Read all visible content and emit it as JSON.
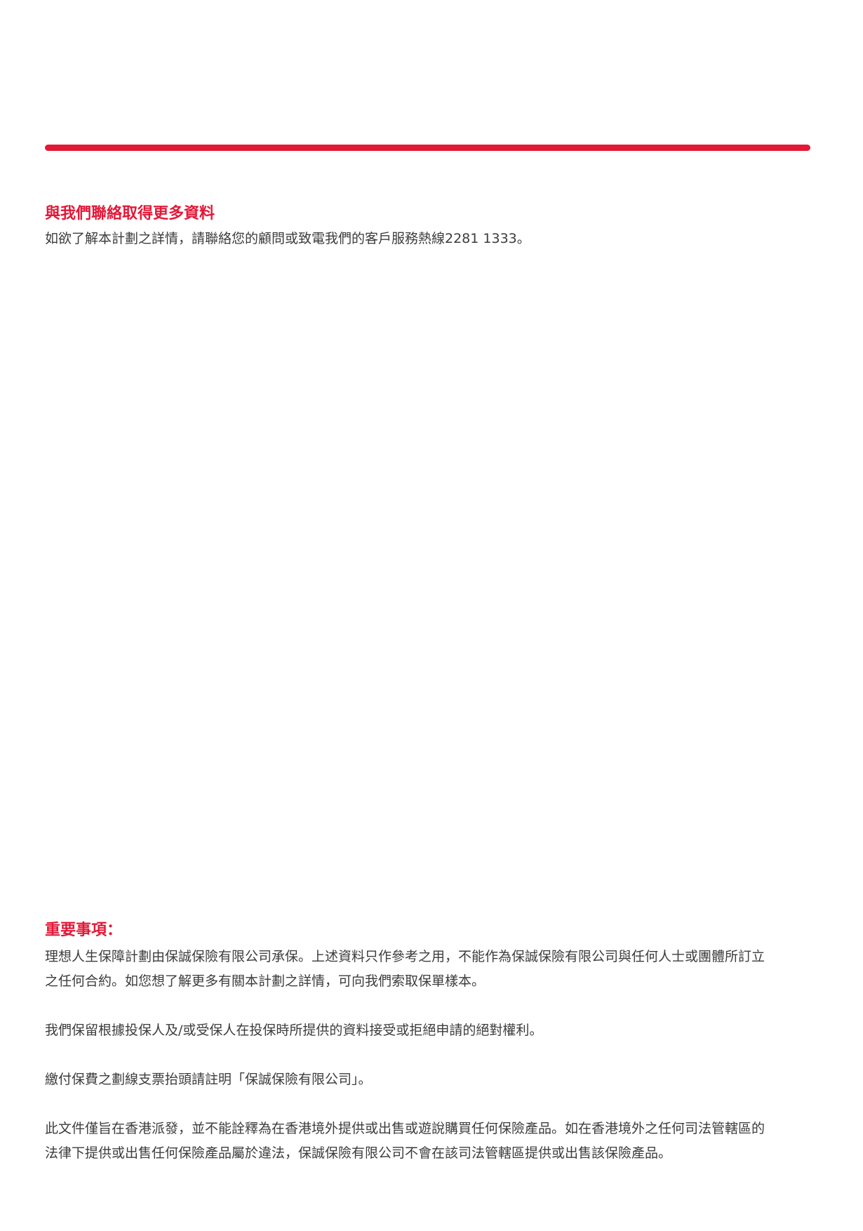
{
  "accent_color": "#e31837",
  "contact": {
    "heading": "與我們聯絡取得更多資料",
    "body": "如欲了解本計劃之詳情，請聯絡您的顧問或致電我們的客戶服務熱線2281 1333。"
  },
  "important": {
    "heading": "重要事項：",
    "paragraphs": [
      {
        "lines": [
          "理想人生保障計劃由保誠保險有限公司承保。上述資料只作參考之用，不能作為保誠保險有限公司與任何人士或團體所訂立",
          "之任何合約。如您想了解更多有關本計劃之詳情，可向我們索取保單樣本。"
        ]
      },
      {
        "lines": [
          "我們保留根據投保人及/或受保人在投保時所提供的資料接受或拒絕申請的絕對權利。"
        ]
      },
      {
        "lines": [
          "繳付保費之劃線支票抬頭請註明「保誠保險有限公司」。"
        ]
      },
      {
        "lines": [
          "此文件僅旨在香港派發，並不能詮釋為在香港境外提供或出售或遊說購買任何保險產品。如在香港境外之任何司法管轄區的",
          "法律下提供或出售任何保險產品屬於違法，保誠保險有限公司不會在該司法管轄區提供或出售該保險產品。"
        ]
      }
    ]
  }
}
